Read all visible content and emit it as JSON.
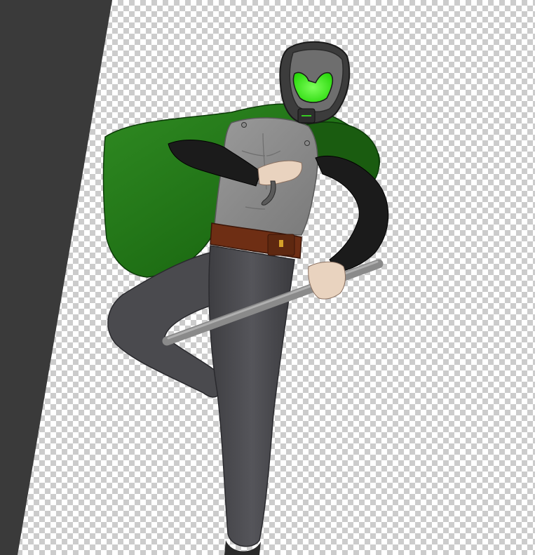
{
  "canvas": {
    "background": "transparency-checkerboard"
  },
  "artwork": {
    "subject": "armored-figure-with-cape-and-staff",
    "colors": {
      "wall": "#3a3a3a",
      "helmet": "#3c3c3c",
      "visor": "#39ff14",
      "cape": "#1e6e14",
      "cape_dark": "#0f4a0a",
      "torso": "#8e8e8e",
      "sleeves": "#1b1b1b",
      "skin": "#e9d3bf",
      "belt": "#6e2e14",
      "buckle": "#d4a12a",
      "pants": "#4a4a4e",
      "staff": "#8a8a8a"
    }
  }
}
